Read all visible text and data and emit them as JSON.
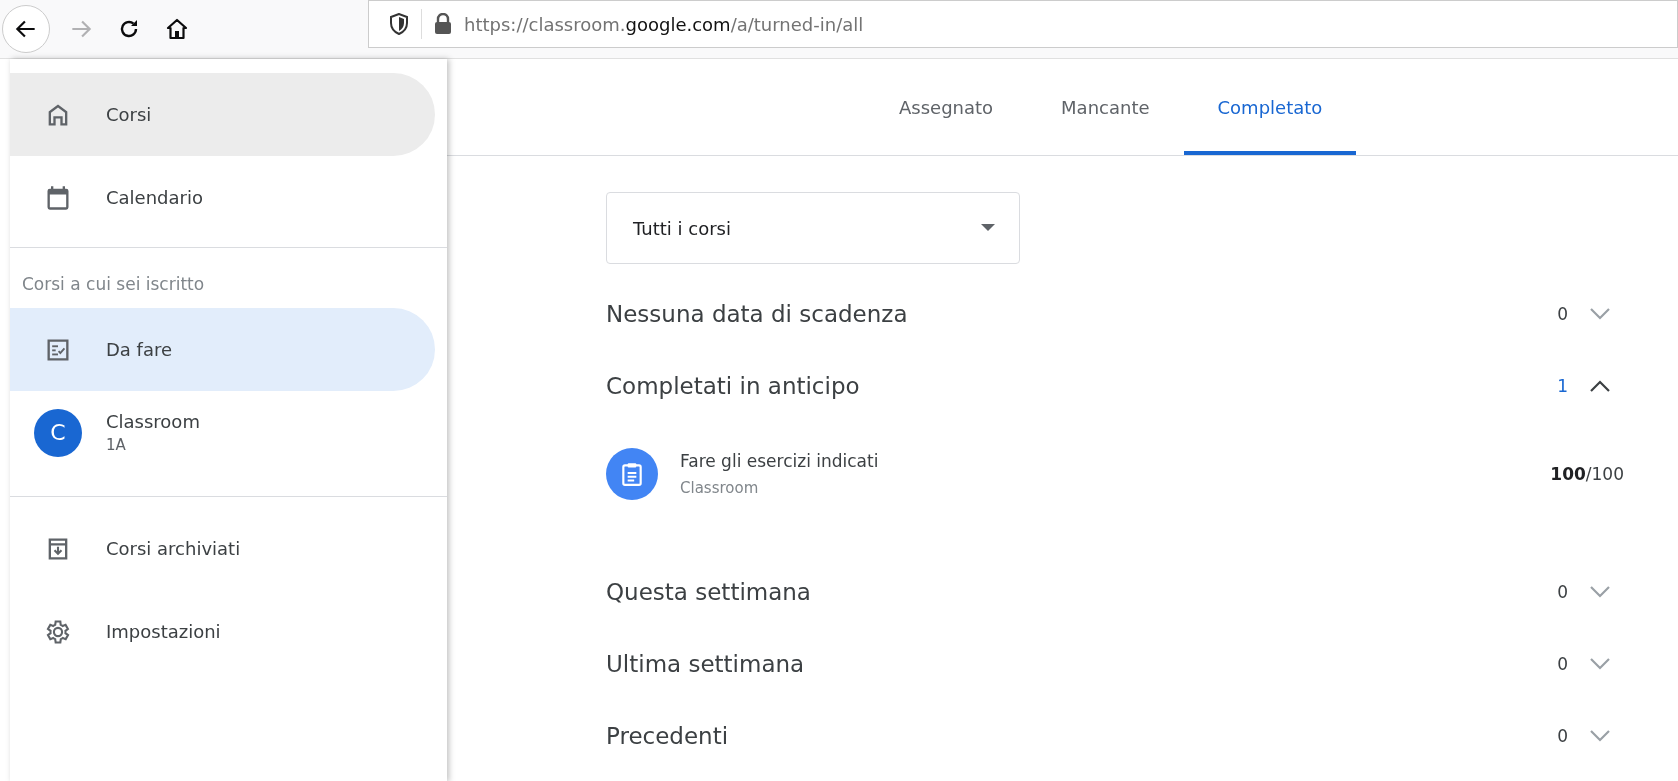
{
  "browser": {
    "forward_disabled": true,
    "url": {
      "scheme_host": "https://classroom.",
      "domain": "google.com",
      "path": "/a/turned-in/all"
    }
  },
  "sidebar": {
    "top_items": [
      {
        "label": "Corsi",
        "hovered": true,
        "selected": false
      },
      {
        "label": "Calendario",
        "hovered": false,
        "selected": false
      }
    ],
    "section_label": "Corsi a cui sei iscritto",
    "enrolled_items": [
      {
        "kind": "nav",
        "label": "Da fare",
        "selected": true
      },
      {
        "kind": "course",
        "label": "Classroom",
        "subtitle": "1A",
        "avatar_letter": "C",
        "color": "#1967d2",
        "selected": false
      }
    ],
    "bottom_items": [
      {
        "label": "Corsi archiviati",
        "hovered": false,
        "selected": false
      },
      {
        "label": "Impostazioni",
        "hovered": false,
        "selected": false
      }
    ]
  },
  "tabs": [
    {
      "label": "Assegnato",
      "selected": false
    },
    {
      "label": "Mancante",
      "selected": false
    },
    {
      "label": "Completato",
      "selected": true
    }
  ],
  "course_filter": {
    "value": "Tutti i corsi"
  },
  "sections": [
    {
      "title": "Nessuna data di scadenza",
      "count": "0",
      "expanded": false
    },
    {
      "title": "Completati in anticipo",
      "count": "1",
      "expanded": true,
      "items": [
        {
          "title": "Fare gli esercizi indicati",
          "course": "Classroom",
          "score": "**100**/100"
        }
      ]
    },
    {
      "title": "Questa settimana",
      "count": "0",
      "expanded": false
    },
    {
      "title": "Ultima settimana",
      "count": "0",
      "expanded": false
    },
    {
      "title": "Precedenti",
      "count": "0",
      "expanded": false
    }
  ]
}
